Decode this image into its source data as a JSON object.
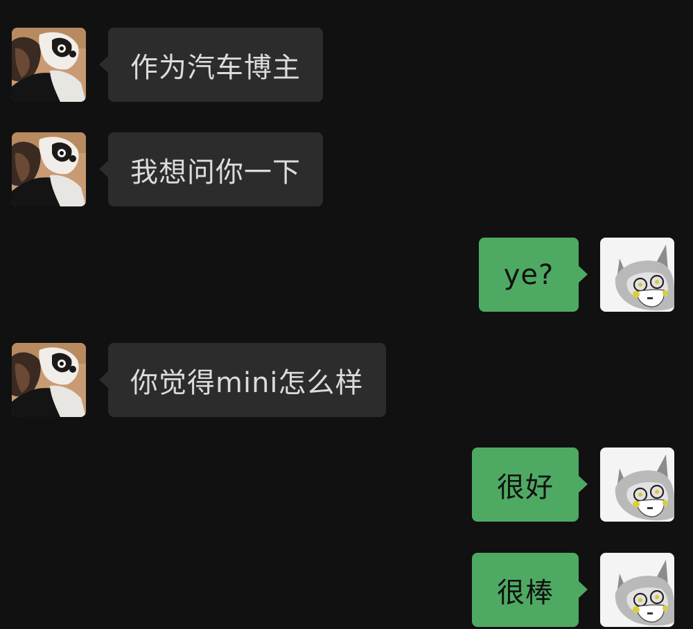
{
  "messages": [
    {
      "side": "left",
      "text": "作为汽车博主",
      "avatar_icon": "dog-avatar-icon"
    },
    {
      "side": "left",
      "text": "我想问你一下",
      "avatar_icon": "dog-avatar-icon"
    },
    {
      "side": "right",
      "text": "ye?",
      "avatar_icon": "cat-mask-avatar-icon"
    },
    {
      "side": "left",
      "text": "你觉得mini怎么样",
      "avatar_icon": "dog-avatar-icon"
    },
    {
      "side": "right",
      "text": "很好",
      "avatar_icon": "cat-mask-avatar-icon"
    },
    {
      "side": "right",
      "text": "很棒",
      "avatar_icon": "cat-mask-avatar-icon"
    }
  ],
  "colors": {
    "background": "#111111",
    "incoming_bubble": "#2c2c2c",
    "incoming_text": "#dcdcdc",
    "outgoing_bubble": "#4eaa62",
    "outgoing_text": "#111111"
  }
}
